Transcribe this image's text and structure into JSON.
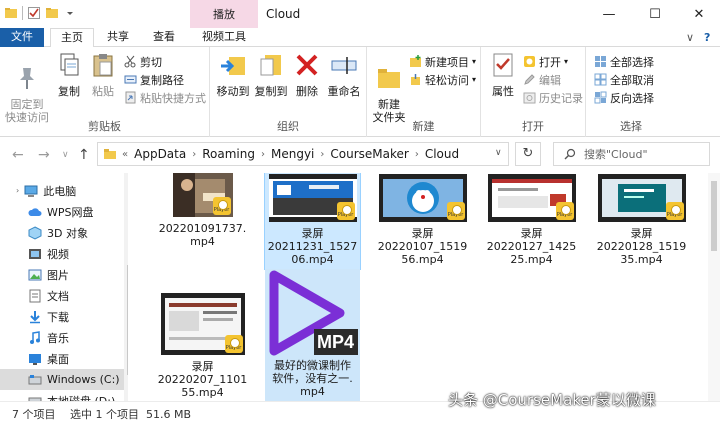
{
  "titlebar": {
    "context_tab": "播放",
    "title": "Cloud",
    "minimize": "—",
    "maximize": "☐",
    "close": "✕"
  },
  "tabs": {
    "file": "文件",
    "home": "主页",
    "share": "共享",
    "view": "查看",
    "video_tools": "视频工具",
    "expand": "∨",
    "help": "?"
  },
  "ribbon": {
    "clipboard": {
      "label": "剪贴板",
      "pin": "固定到\n快速访问",
      "copy": "复制",
      "paste": "粘贴",
      "cut": "剪切",
      "copy_path": "复制路径",
      "paste_shortcut": "粘贴快捷方式"
    },
    "organize": {
      "label": "组织",
      "move_to": "移动到",
      "copy_to": "复制到",
      "delete": "删除",
      "rename": "重命名"
    },
    "new": {
      "label": "新建",
      "new_folder": "新建\n文件夹",
      "new_item": "新建项目",
      "easy_access": "轻松访问"
    },
    "open": {
      "label": "打开",
      "properties": "属性",
      "open": "打开",
      "edit": "编辑",
      "history": "历史记录"
    },
    "select": {
      "label": "选择",
      "select_all": "全部选择",
      "select_none": "全部取消",
      "invert": "反向选择"
    }
  },
  "address": {
    "crumbs": [
      "AppData",
      "Roaming",
      "Mengyi",
      "CourseMaker",
      "Cloud"
    ],
    "overflow": "«",
    "search_placeholder": "搜索\"Cloud\""
  },
  "nav_items": [
    {
      "label": "此电脑"
    },
    {
      "label": "WPS网盘"
    },
    {
      "label": "3D 对象"
    },
    {
      "label": "视频"
    },
    {
      "label": "图片"
    },
    {
      "label": "文档"
    },
    {
      "label": "下载"
    },
    {
      "label": "音乐"
    },
    {
      "label": "桌面"
    },
    {
      "label": "Windows (C:)"
    },
    {
      "label": "本地磁盘 (D:)"
    }
  ],
  "files": [
    {
      "name": "202201091737.\nmp4"
    },
    {
      "name": "录屏\n20211231_1527\n06.mp4"
    },
    {
      "name": "录屏\n20220107_1519\n56.mp4"
    },
    {
      "name": "录屏\n20220127_1425\n25.mp4"
    },
    {
      "name": "录屏\n20220128_1519\n35.mp4"
    },
    {
      "name": "录屏\n20220207_1101\n55.mp4"
    },
    {
      "name": "最好的微课制作\n软件，没有之一.\nmp4",
      "badge": "MP4"
    }
  ],
  "status": {
    "count": "7 个项目",
    "selection": "选中 1 个项目  51.6 MB"
  },
  "watermark": "头条 @CourseMaker蒙以微课",
  "colors": {
    "file_tab": "#1a5fa8",
    "context_tab": "#f6d8e6",
    "selection": "#cce8ff",
    "mp4_purple": "#7b2fd6"
  }
}
